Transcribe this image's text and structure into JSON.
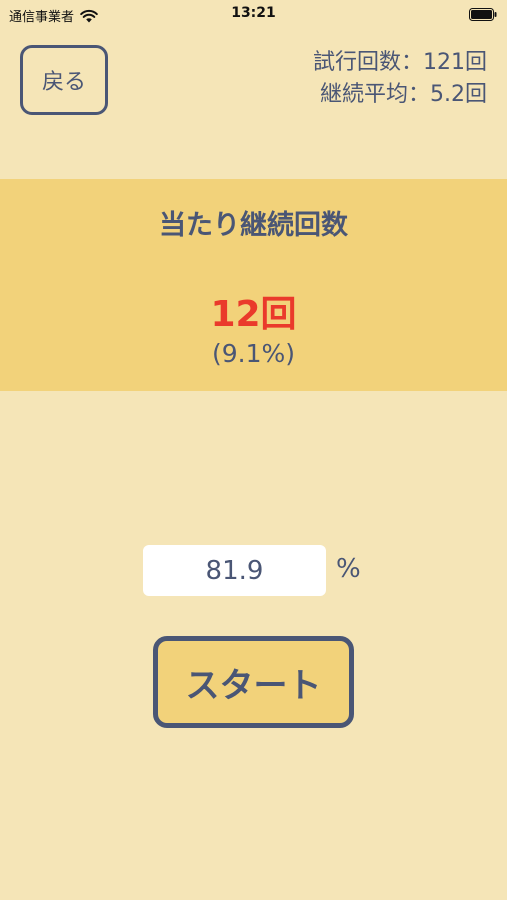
{
  "status_bar": {
    "carrier": "通信事業者",
    "time": "13:21",
    "wifi_icon": "wifi-icon",
    "battery_icon": "battery-icon"
  },
  "header": {
    "back_label": "戻る",
    "trials_label": "試行回数：",
    "trials_value": "121回",
    "average_label": "継続平均：",
    "average_value": "5.2回"
  },
  "result": {
    "title": "当たり継続回数",
    "count": "12回",
    "percent": "(9.1%)"
  },
  "probability": {
    "value": "81.9",
    "unit": "%"
  },
  "start_label": "スタート",
  "colors": {
    "background": "#f5e5b7",
    "panel": "#f2d27a",
    "text": "#4a5675",
    "accent_red": "#ea3a2b"
  }
}
